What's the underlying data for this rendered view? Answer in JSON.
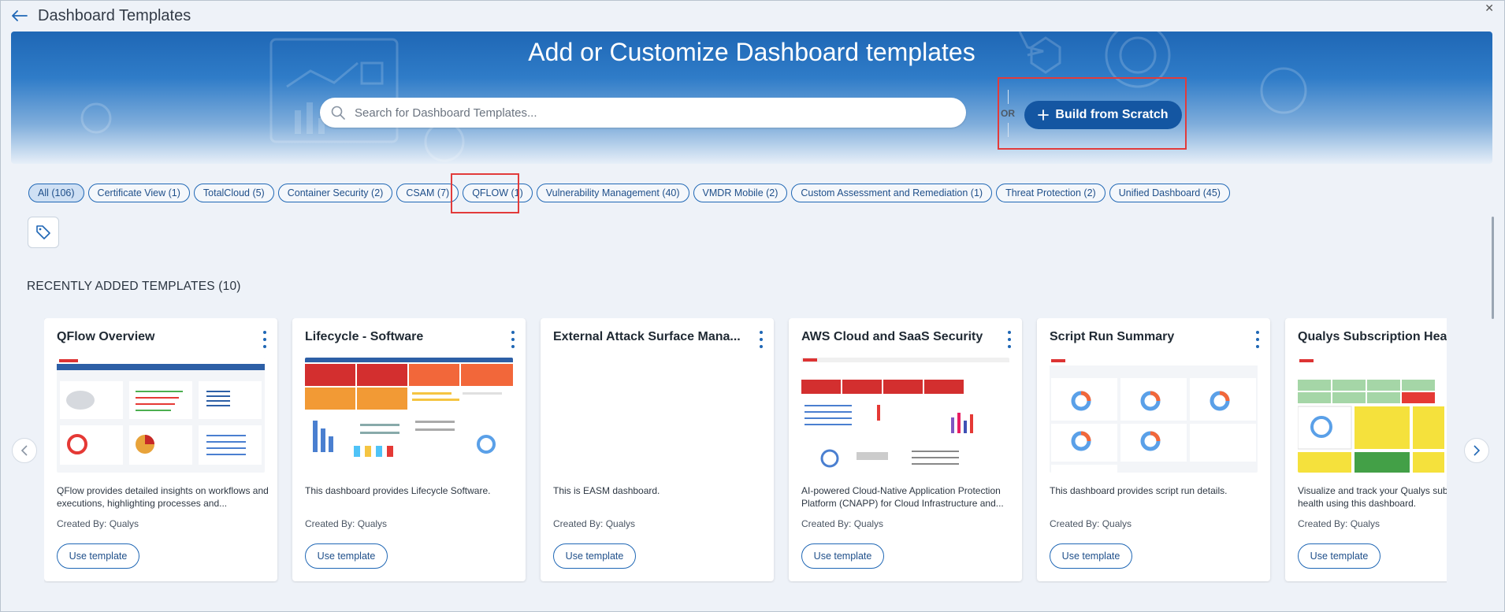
{
  "header": {
    "title": "Dashboard Templates"
  },
  "hero": {
    "title": "Add or Customize Dashboard templates",
    "search_placeholder": "Search for Dashboard Templates...",
    "or_label": "OR",
    "build_button_label": "Build from Scratch"
  },
  "filters": [
    {
      "label": "All (106)",
      "active": true
    },
    {
      "label": "Certificate View (1)"
    },
    {
      "label": "TotalCloud (5)"
    },
    {
      "label": "Container Security (2)"
    },
    {
      "label": "CSAM (7)"
    },
    {
      "label": "QFLOW (1)"
    },
    {
      "label": "Vulnerability Management (40)"
    },
    {
      "label": "VMDR Mobile (2)"
    },
    {
      "label": "Custom Assessment and Remediation (1)"
    },
    {
      "label": "Threat Protection (2)"
    },
    {
      "label": "Unified Dashboard (45)"
    }
  ],
  "recent": {
    "section_title": "RECENTLY ADDED TEMPLATES (10)",
    "cards": [
      {
        "title": "QFlow Overview",
        "description": "QFlow provides detailed insights on workflows and executions, highlighting processes and...",
        "creator": "Created By: Qualys",
        "button": "Use template"
      },
      {
        "title": "Lifecycle - Software",
        "description": "This dashboard provides Lifecycle Software.",
        "creator": "Created By: Qualys",
        "button": "Use template"
      },
      {
        "title": "External Attack Surface Mana...",
        "description": "This is EASM dashboard.",
        "creator": "Created By: Qualys",
        "button": "Use template"
      },
      {
        "title": "AWS Cloud and SaaS Security",
        "description": "AI-powered Cloud-Native Application Protection Platform (CNAPP) for Cloud Infrastructure and...",
        "creator": "Created By: Qualys",
        "button": "Use template"
      },
      {
        "title": "Script Run Summary",
        "description": "This dashboard provides script run details.",
        "creator": "Created By: Qualys",
        "button": "Use template"
      },
      {
        "title": "Qualys Subscription Health",
        "description": "Visualize and track your Qualys subscription health using this dashboard.",
        "creator": "Created By: Qualys",
        "button": "Use template"
      }
    ]
  },
  "colors": {
    "primary": "#1456a2",
    "highlight": "#e23b3b",
    "hero_top": "#1f67b5"
  }
}
